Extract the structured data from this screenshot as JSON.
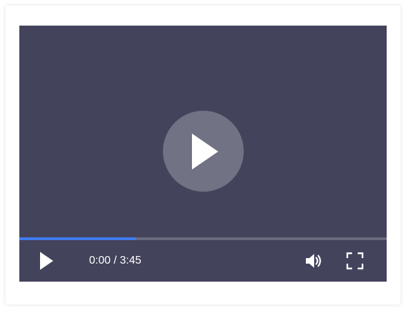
{
  "player": {
    "background_color": "#43435c",
    "accent_color": "#3f7cf0",
    "current_time": "0:00",
    "separator": " / ",
    "duration": "3:45",
    "progress_fraction": 0.318,
    "icons": {
      "big_play": "play-icon",
      "control_play": "play-icon",
      "volume": "volume-icon",
      "fullscreen": "fullscreen-icon"
    }
  }
}
